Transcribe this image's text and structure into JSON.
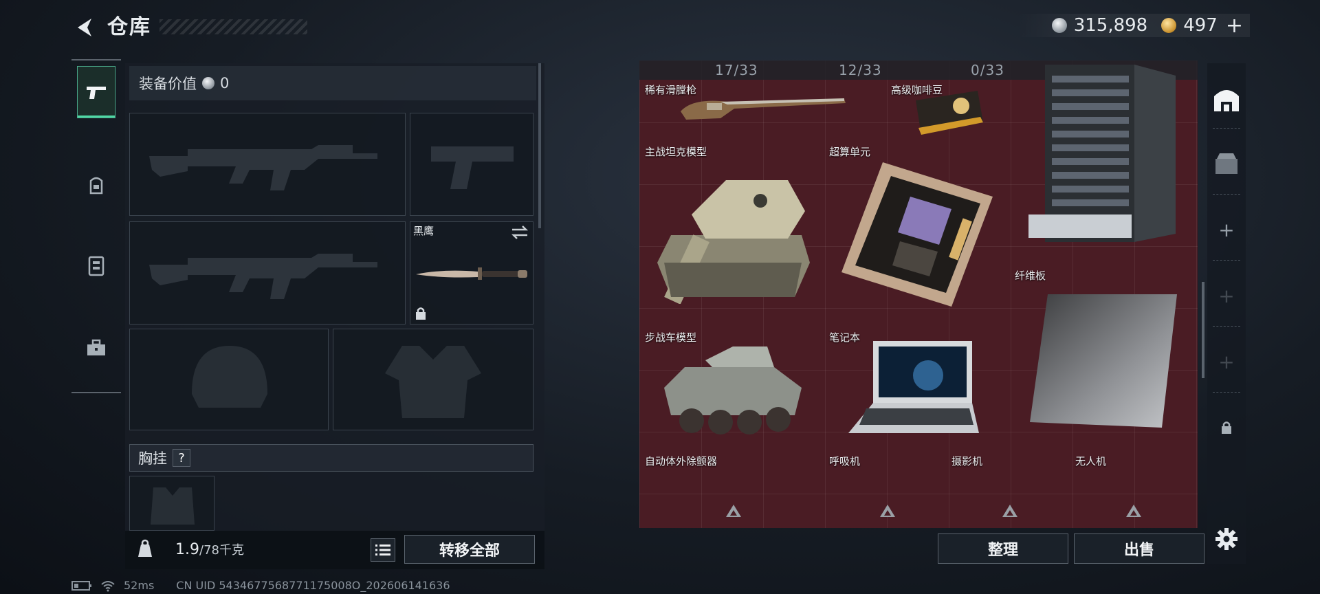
{
  "header": {
    "title": "仓库",
    "currency": {
      "silver": "315,898",
      "gold": "497",
      "add_label": "+"
    }
  },
  "equipment": {
    "value_label": "装备价值",
    "value": "0",
    "knife_name": "黑鹰",
    "chest_rig_label": "胸挂",
    "help_label": "?",
    "weight_current": "1.9",
    "weight_max": "/78千克",
    "transfer_all": "转移全部"
  },
  "storage": {
    "counters": [
      "17/33",
      "12/33",
      "0/33"
    ],
    "items": [
      {
        "name": "稀有滑膛枪"
      },
      {
        "name": "高级咖啡豆"
      },
      {
        "name": "主战坦克模型"
      },
      {
        "name": "超算单元"
      },
      {
        "name": "纤维板"
      },
      {
        "name": "步战车模型"
      },
      {
        "name": "笔记本"
      },
      {
        "name": "自动体外除颤器"
      },
      {
        "name": "呼吸机"
      },
      {
        "name": "摄影机"
      },
      {
        "name": "无人机"
      }
    ],
    "tidy_label": "整理",
    "sell_label": "出售"
  },
  "status": {
    "ping": "52ms",
    "uid": "CN UID 5434677568771175008O_202606141636"
  },
  "colors": {
    "grid_bg": "#4a1c24",
    "accent": "#50d8a5"
  }
}
